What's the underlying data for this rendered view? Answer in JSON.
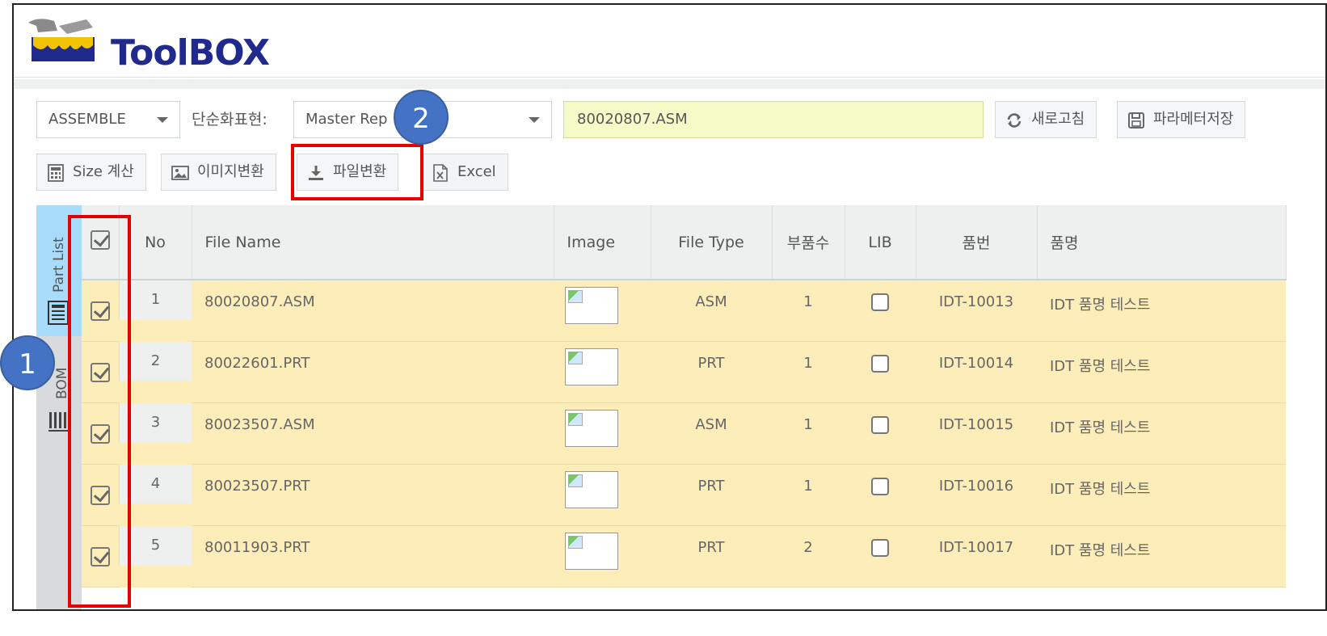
{
  "app": {
    "logo_text": "ToolBOX"
  },
  "toolbar": {
    "mode_select": "ASSEMBLE",
    "simplify_label": "단순화표현:",
    "rep_select": "Master Rep",
    "file_field": "80020807.ASM",
    "refresh_label": "새로고침",
    "save_params_label": "파라메터저장",
    "size_calc_label": "Size 계산",
    "image_convert_label": "이미지변환",
    "file_convert_label": "파일변환",
    "excel_label": "Excel"
  },
  "sidebar": {
    "tabs": [
      {
        "label": "Part List",
        "active": true
      },
      {
        "label": "BOM",
        "active": false
      }
    ]
  },
  "table": {
    "columns": [
      "",
      "No",
      "File Name",
      "Image",
      "File Type",
      "부품수",
      "LIB",
      "품번",
      "품명"
    ],
    "header_checked": true,
    "rows": [
      {
        "checked": true,
        "no": "1",
        "file_name": "80020807.ASM",
        "file_type": "ASM",
        "parts": "1",
        "lib": false,
        "part_no": "IDT-10013",
        "part_name": "IDT 품명 테스트"
      },
      {
        "checked": true,
        "no": "2",
        "file_name": "80022601.PRT",
        "file_type": "PRT",
        "parts": "1",
        "lib": false,
        "part_no": "IDT-10014",
        "part_name": "IDT 품명 테스트"
      },
      {
        "checked": true,
        "no": "3",
        "file_name": "80023507.ASM",
        "file_type": "ASM",
        "parts": "1",
        "lib": false,
        "part_no": "IDT-10015",
        "part_name": "IDT 품명 테스트"
      },
      {
        "checked": true,
        "no": "4",
        "file_name": "80023507.PRT",
        "file_type": "PRT",
        "parts": "1",
        "lib": false,
        "part_no": "IDT-10016",
        "part_name": "IDT 품명 테스트"
      },
      {
        "checked": true,
        "no": "5",
        "file_name": "80011903.PRT",
        "file_type": "PRT",
        "parts": "2",
        "lib": false,
        "part_no": "IDT-10017",
        "part_name": "IDT 품명 테스트"
      }
    ]
  },
  "annotations": {
    "badge_1": "1",
    "badge_2": "2",
    "highlight_color": "#e60000",
    "badge_color": "#4472c4"
  }
}
